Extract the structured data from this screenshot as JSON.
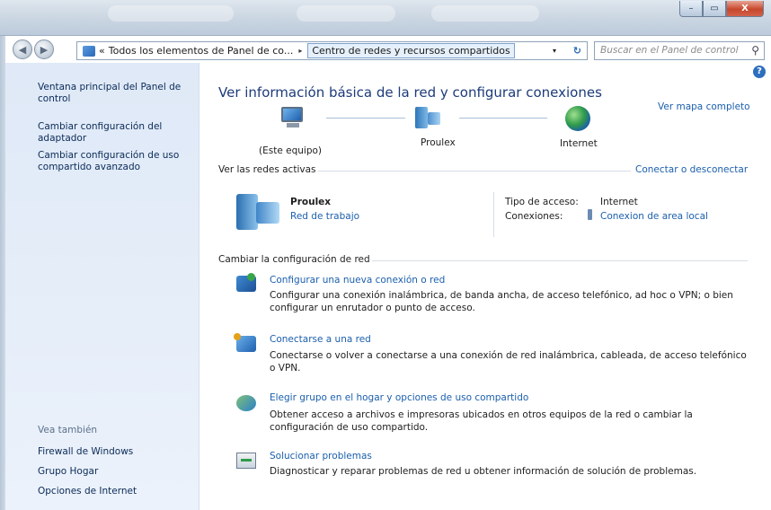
{
  "window": {
    "minimize_glyph": "–",
    "maximize_glyph": "▭",
    "close_glyph": "X"
  },
  "addressbar": {
    "back_glyph": "◀",
    "forward_glyph": "▶",
    "overflow": "«",
    "crumb1": "Todos los elementos de Panel de co...",
    "crumb_sep": "▸",
    "crumb2": "Centro de redes y recursos compartidos",
    "dropdown_glyph": "▾",
    "refresh_glyph": "↻"
  },
  "search": {
    "placeholder": "Buscar en el Panel de control",
    "icon_glyph": "⚲"
  },
  "sidebar": {
    "items": [
      "Ventana principal del Panel de control",
      "Cambiar configuración del adaptador",
      "Cambiar configuración de uso compartido avanzado"
    ],
    "see_also_title": "Vea también",
    "see_also": [
      "Firewall de Windows",
      "Grupo Hogar",
      "Opciones de Internet"
    ]
  },
  "help_glyph": "?",
  "main": {
    "title": "Ver información básica de la red y configurar conexiones",
    "full_map_link": "Ver mapa completo",
    "map": {
      "computer_label": "(Este equipo)",
      "network_label": "Proulex",
      "internet_label": "Internet"
    },
    "active_networks": {
      "heading": "Ver las redes activas",
      "connect_link": "Conectar o desconectar",
      "network_name": "Proulex",
      "network_type": "Red de trabajo",
      "access_type_label": "Tipo de acceso:",
      "access_type_value": "Internet",
      "connections_label": "Conexiones:",
      "connections_value": "Conexion de area local"
    },
    "change_settings": {
      "heading": "Cambiar la configuración de red",
      "tasks": [
        {
          "title": "Configurar una nueva conexión o red",
          "desc": "Configurar una conexión inalámbrica, de banda ancha, de acceso telefónico, ad hoc o VPN; o bien configurar un enrutador o punto de acceso."
        },
        {
          "title": "Conectarse a una red",
          "desc": "Conectarse o volver a conectarse a una conexión de red inalámbrica, cableada, de acceso telefónico o VPN."
        },
        {
          "title": "Elegir grupo en el hogar y opciones de uso compartido",
          "desc": "Obtener acceso a archivos e impresoras ubicados en otros equipos de la red o cambiar la configuración de uso compartido."
        },
        {
          "title": "Solucionar problemas",
          "desc": "Diagnosticar y reparar problemas de red u obtener información de solución de problemas."
        }
      ]
    }
  }
}
